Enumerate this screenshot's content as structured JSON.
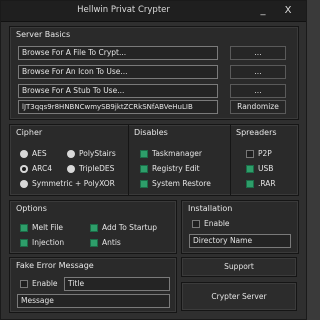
{
  "window": {
    "title": "Hellwin Privat Crypter",
    "minimize_label": "_",
    "close_label": "X"
  },
  "server_basics": {
    "title": "Server Basics",
    "file_field": "Browse For A File To Crypt...",
    "icon_field": "Browse For An Icon To Use...",
    "stub_field": "Browse For A Stub To Use...",
    "key_field": "lJT3qqs9r8HNBNCwmySB9jktZCRkSNfABVeHuLIB",
    "browse_label": "...",
    "randomize_label": "Randomize"
  },
  "cipher": {
    "title": "Cipher",
    "options": [
      {
        "label": "AES",
        "selected": false
      },
      {
        "label": "PolyStairs",
        "selected": false
      },
      {
        "label": "ARC4",
        "selected": true
      },
      {
        "label": "TripleDES",
        "selected": false
      },
      {
        "label": "Symmetric + PolyXOR",
        "selected": false
      }
    ]
  },
  "disables": {
    "title": "Disables",
    "items": [
      {
        "label": "Taskmanager",
        "checked": true
      },
      {
        "label": "Registry Edit",
        "checked": true
      },
      {
        "label": "System Restore",
        "checked": true
      }
    ]
  },
  "spreaders": {
    "title": "Spreaders",
    "items": [
      {
        "label": "P2P",
        "checked": false
      },
      {
        "label": "USB",
        "checked": true
      },
      {
        "label": ".RAR",
        "checked": true
      }
    ]
  },
  "options": {
    "title": "Options",
    "items": [
      {
        "label": "Melt File",
        "checked": true
      },
      {
        "label": "Add To Startup",
        "checked": true
      },
      {
        "label": "Injection",
        "checked": true
      },
      {
        "label": "Antis",
        "checked": true
      }
    ]
  },
  "installation": {
    "title": "Installation",
    "enable_label": "Enable",
    "enable_checked": false,
    "directory_field": "Directory Name"
  },
  "fake_error": {
    "title": "Fake Error Message",
    "enable_label": "Enable",
    "enable_checked": false,
    "title_field": "Title",
    "message_field": "Message"
  },
  "buttons": {
    "support": "Support",
    "crypt": "Crypter Server"
  }
}
